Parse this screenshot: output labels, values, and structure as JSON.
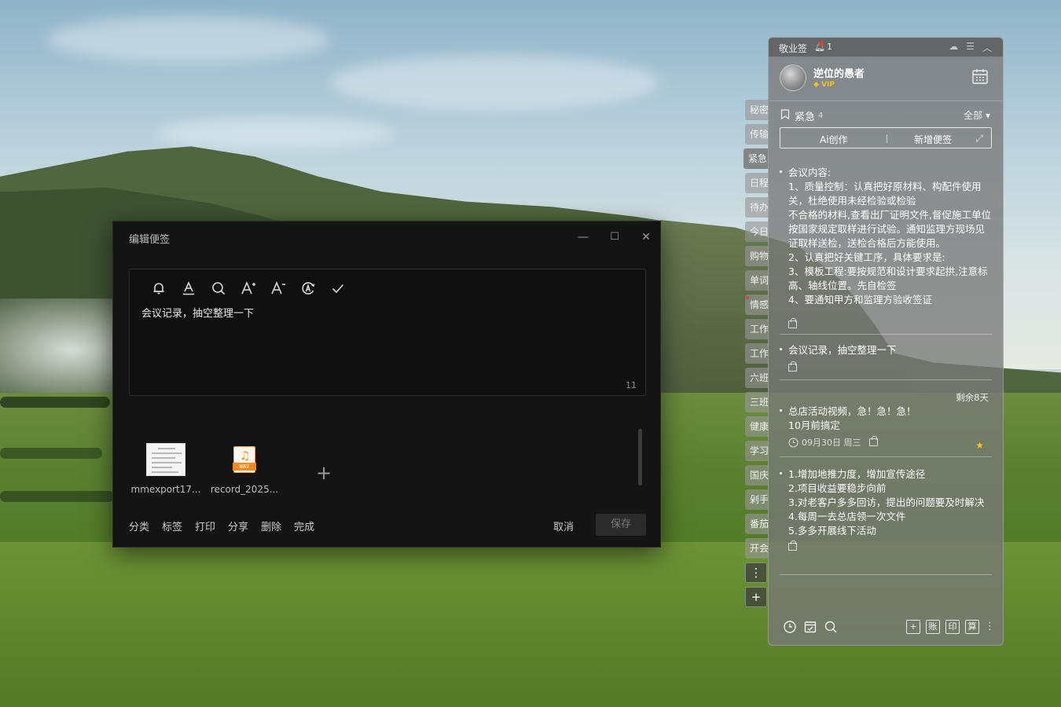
{
  "edit_window": {
    "title": "编辑便签",
    "controls": {
      "minimize": "—",
      "maximize": "☐",
      "close": "✕"
    },
    "toolbar_icons": [
      "bell-icon",
      "text-color-icon",
      "search-icon",
      "font-increase-icon",
      "font-decrease-icon",
      "ai-icon",
      "check-icon"
    ],
    "content": "会议记录，抽空整理一下",
    "char_count": "11",
    "attachments": [
      {
        "name": "mmexport17...",
        "type": "image"
      },
      {
        "name": "record_2025...",
        "type": "wav",
        "badge": "WAV"
      }
    ],
    "add_attachment": "+",
    "actions": [
      "分类",
      "标签",
      "打印",
      "分享",
      "删除",
      "完成"
    ],
    "cancel": "取消",
    "save": "保存"
  },
  "side_tabs": [
    {
      "label": "秘密"
    },
    {
      "label": "传输"
    },
    {
      "label": "紧急",
      "active": true
    },
    {
      "label": "日程"
    },
    {
      "label": "待办"
    },
    {
      "label": "今日"
    },
    {
      "label": "购物"
    },
    {
      "label": "单词"
    },
    {
      "label": "情感",
      "dot": true
    },
    {
      "label": "工作"
    },
    {
      "label": "工作"
    },
    {
      "label": "六班"
    },
    {
      "label": "三班"
    },
    {
      "label": "健康"
    },
    {
      "label": "学习"
    },
    {
      "label": "国庆"
    },
    {
      "label": "剁手"
    },
    {
      "label": "番茄"
    },
    {
      "label": "开会"
    }
  ],
  "side_tools": {
    "more": "⋮",
    "add": "+"
  },
  "panel": {
    "app_name": "敬业签",
    "notification_count": "1",
    "username": "逆位的愚者",
    "vip": "VIP",
    "category": {
      "name": "紧急",
      "count": "4",
      "filter": "全部"
    },
    "action_bar": {
      "ai": "Ai创作",
      "new_note": "新增便签"
    },
    "notes": [
      {
        "text": "会议内容:\n1、质量控制：认真把好原材料、构配件使用关，杜绝使用未经检验或检验\n不合格的材料,查看出厂证明文件,督促施工单位按国家规定取样进行试验。通知监理方现场见证取样送检，送检合格后方能使用。\n2、认真把好关键工序，具体要求是:\n3、模板工程:要按规范和设计要求起拱,注意标高、轴线位置。先自检签\n4、要通知甲方和监理方验收签证"
      },
      {
        "text": "会议记录，抽空整理一下"
      },
      {
        "text": "总店活动视频，急！急！急！\n10月前搞定",
        "remaining": "剩余8天",
        "date": "09月30日 周三",
        "starred": true
      },
      {
        "text": "1.增加地推力度，增加宣传途径\n2.项目收益要稳步向前\n3.对老客户多多回访，提出的问题要及时解决\n4.每周一去总店领一次文件\n5.多多开展线下活动"
      }
    ],
    "footer": {
      "left_icons": [
        "clock-icon",
        "checklist-icon",
        "search-icon"
      ],
      "right_buttons": [
        "+",
        "账",
        "印",
        "算"
      ]
    }
  }
}
